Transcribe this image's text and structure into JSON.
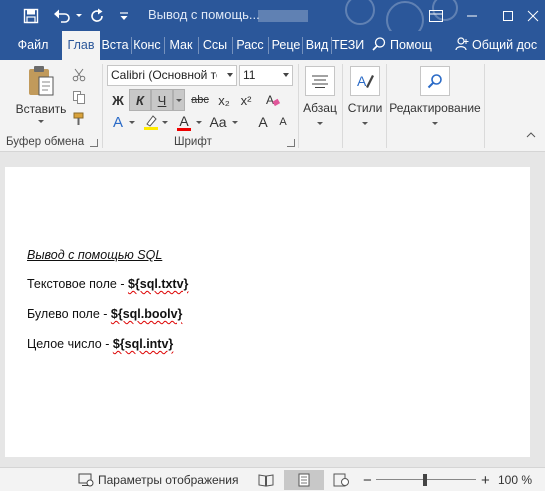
{
  "titlebar": {
    "title": "Вывод с помощь...",
    "colors": {
      "accent": "#2b579a"
    },
    "icons": [
      "save-icon",
      "undo-icon",
      "redo-icon",
      "customize-icon",
      "ribbon-display-icon",
      "minimize-icon",
      "maximize-icon",
      "close-icon"
    ]
  },
  "tabs": [
    {
      "label": "Файл",
      "active": false
    },
    {
      "label": "Глав",
      "active": true
    },
    {
      "label": "Вста",
      "active": false
    },
    {
      "label": "Конс",
      "active": false
    },
    {
      "label": "Мак",
      "active": false
    },
    {
      "label": "Ссы",
      "active": false
    },
    {
      "label": "Расс",
      "active": false
    },
    {
      "label": "Реце",
      "active": false
    },
    {
      "label": "Вид",
      "active": false
    },
    {
      "label": "ТЕЗИ",
      "active": false
    }
  ],
  "tell_me": "Помощ",
  "share": "Общий дос",
  "ribbon": {
    "clipboard": {
      "paste_label": "Вставить",
      "group_label": "Буфер обмена"
    },
    "font": {
      "font_name": "Calibri (Основной тек",
      "font_size": "11",
      "bold": "Ж",
      "italic": "К",
      "underline": "Ч",
      "strike": "abc",
      "subscript": "x₂",
      "superscript": "x²",
      "text_effects": "A",
      "font_color": "A",
      "grow": "A",
      "shrink": "A",
      "change_case": "Aa",
      "group_label": "Шрифт"
    },
    "paragraph": {
      "label": "Абзац"
    },
    "styles": {
      "label": "Стили"
    },
    "editing": {
      "label": "Редактирование"
    }
  },
  "document": {
    "heading": "Вывод с помощью SQL",
    "lines": [
      {
        "prefix": "Текстовое поле - ",
        "field": "${sql.txtv}"
      },
      {
        "prefix": "Булево поле - ",
        "field": "${sql.boolv}"
      },
      {
        "prefix": "Целое число - ",
        "field": "${sql.intv}"
      }
    ]
  },
  "statusbar": {
    "display_settings": "Параметры отображения",
    "zoom_minus": "−",
    "zoom_plus": "+",
    "zoom": "100 %"
  }
}
